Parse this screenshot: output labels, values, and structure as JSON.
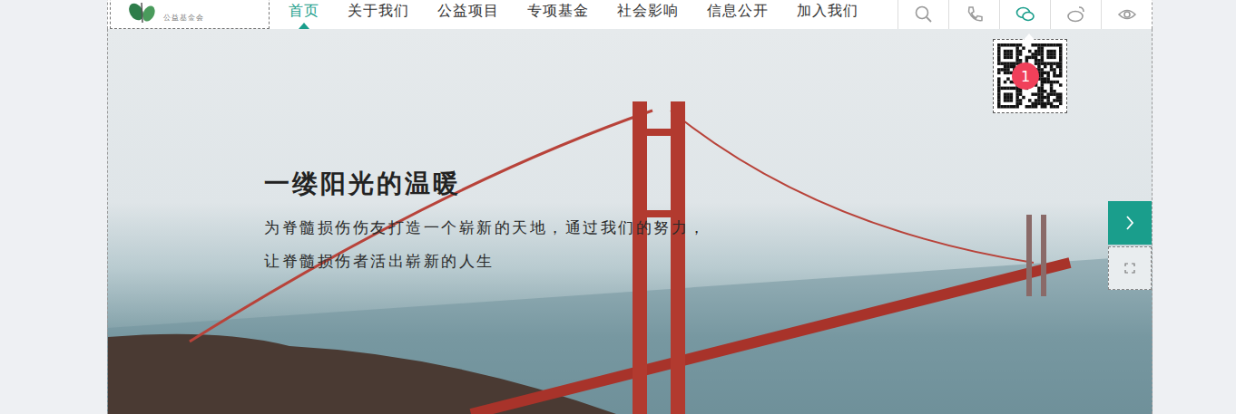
{
  "logo": {
    "subtitle": "公益基金会"
  },
  "nav": [
    {
      "label": "首页",
      "selected": true
    },
    {
      "label": "关于我们",
      "selected": false
    },
    {
      "label": "公益项目",
      "selected": false
    },
    {
      "label": "专项基金",
      "selected": false
    },
    {
      "label": "社会影响",
      "selected": false
    },
    {
      "label": "信息公开",
      "selected": false
    },
    {
      "label": "加入我们",
      "selected": false
    }
  ],
  "header_icons": [
    {
      "kind": "search",
      "selected": false
    },
    {
      "kind": "phone",
      "selected": false
    },
    {
      "kind": "wechat",
      "selected": true
    },
    {
      "kind": "weibo",
      "selected": false
    },
    {
      "kind": "eye",
      "selected": false
    }
  ],
  "hero": {
    "title": "一缕阳光的温暖",
    "lines": [
      "为脊髓损伤伤友打造一个崭新的天地，通过我们的努力，",
      "让脊髓损伤者活出崭新的人生"
    ]
  },
  "qr_popup": {
    "badge": "1"
  }
}
